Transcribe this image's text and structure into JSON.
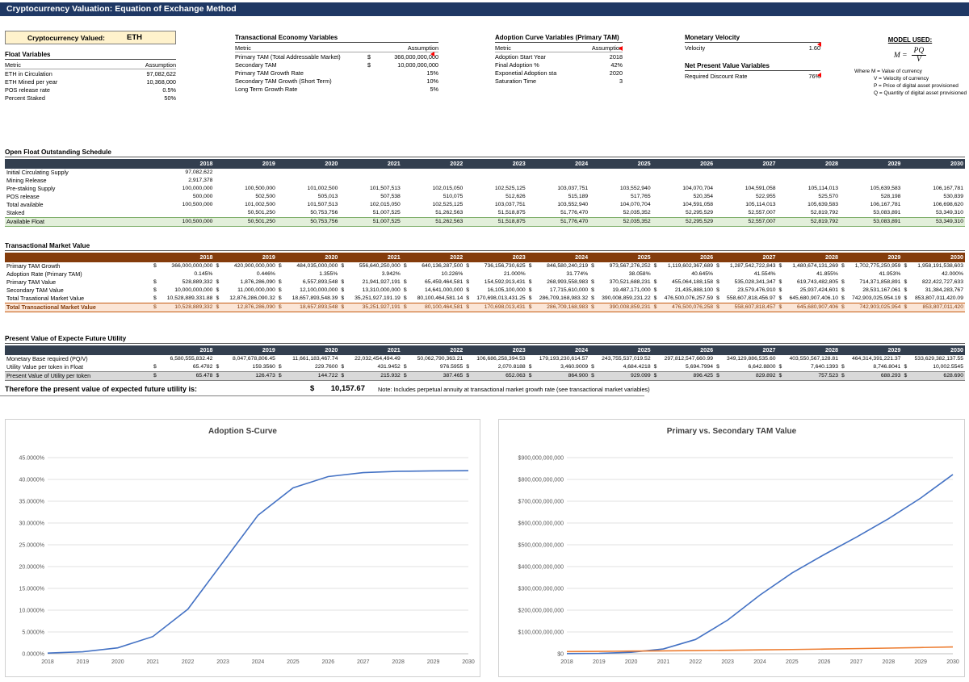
{
  "title_bar": {
    "title": "Cryptocurrency Valuation: Equation of Exchange Method"
  },
  "crypto_box": {
    "label": "Cryptocurrency Valued:",
    "value": "ETH"
  },
  "float_variables": {
    "title": "Float Variables",
    "headers": [
      "Metric",
      "Assumption"
    ],
    "rows": [
      {
        "metric": "ETH in Circulation",
        "value": "97,082,622"
      },
      {
        "metric": "ETH Mined per year",
        "value": "10,368,000"
      },
      {
        "metric": "POS release rate",
        "value": "0.5%"
      },
      {
        "metric": "Percent Staked",
        "value": "50%"
      }
    ]
  },
  "transactional_economy": {
    "title": "Transactional Economy Variables",
    "headers": [
      "Metric",
      "Assumption"
    ],
    "rows": [
      {
        "metric": "Primary TAM (Total Addressable Market)",
        "currency": "$",
        "value": "366,000,000,000"
      },
      {
        "metric": "Secondary TAM",
        "currency": "$",
        "value": "10,000,000,000"
      },
      {
        "metric": "Primary TAM Growth Rate",
        "value": "15%"
      },
      {
        "metric": "Secondary TAM Growth (Short Term)",
        "value": "10%"
      },
      {
        "metric": "Long Term Growth Rate",
        "value": "5%"
      }
    ]
  },
  "adoption_curve": {
    "title": "Adoption Curve Variables (Primary TAM)",
    "headers": [
      "Metric",
      "Assumption"
    ],
    "rows": [
      {
        "metric": "Adoption Start Year",
        "value": "2018"
      },
      {
        "metric": "Final Adoption %",
        "value": "42%"
      },
      {
        "metric": "Exponetial Adoption sta",
        "value": "2020"
      },
      {
        "metric": "Saturation Time",
        "value": "3"
      }
    ]
  },
  "monetary_velocity": {
    "title": "Monetary Velocity",
    "metric": "Velocity",
    "value": "1.60"
  },
  "npv_variables": {
    "title": "Net Present Value Variables",
    "metric": "Required Discount Rate",
    "value": "76%"
  },
  "model_used": {
    "title": "MODEL USED:",
    "formula_lhs": "M =",
    "formula_num": "PQ",
    "formula_den": "V",
    "legend": [
      "Where M = Value of currency",
      "V = Velocity of currency",
      "P = Price of digital asset provisioned",
      "Q = Quantity of digital asset provisioned"
    ]
  },
  "years": [
    "2018",
    "2019",
    "2020",
    "2021",
    "2022",
    "2023",
    "2024",
    "2025",
    "2026",
    "2027",
    "2028",
    "2029",
    "2030"
  ],
  "open_float": {
    "title": "Open Float Outstanding Schedule",
    "theme": "theme-slate",
    "rows": [
      {
        "label": "Initial Circulating Supply",
        "values": [
          "97,082,622",
          "",
          "",
          "",
          "",
          "",
          "",
          "",
          "",
          "",
          "",
          "",
          ""
        ]
      },
      {
        "label": "Mining Release",
        "values": [
          "2,917,378",
          "",
          "",
          "",
          "",
          "",
          "",
          "",
          "",
          "",
          "",
          "",
          ""
        ]
      },
      {
        "label": "Pre-staking Supply",
        "values": [
          "100,000,000",
          "100,500,000",
          "101,002,500",
          "101,507,513",
          "102,015,050",
          "102,525,125",
          "103,037,751",
          "103,552,940",
          "104,070,704",
          "104,591,058",
          "105,114,013",
          "105,639,583",
          "106,167,781"
        ]
      },
      {
        "label": "POS release",
        "values": [
          "500,000",
          "502,500",
          "505,013",
          "507,538",
          "510,075",
          "512,626",
          "515,189",
          "517,765",
          "520,354",
          "522,955",
          "525,570",
          "528,198",
          "530,839"
        ]
      },
      {
        "label": "Total available",
        "values": [
          "100,500,000",
          "101,002,500",
          "101,507,513",
          "102,015,050",
          "102,525,125",
          "103,037,751",
          "103,552,940",
          "104,070,704",
          "104,591,058",
          "105,114,013",
          "105,639,583",
          "106,167,781",
          "106,698,620"
        ]
      },
      {
        "label": "Staked",
        "values": [
          "",
          "50,501,250",
          "50,753,756",
          "51,007,525",
          "51,262,563",
          "51,518,875",
          "51,776,470",
          "52,035,352",
          "52,295,529",
          "52,557,007",
          "52,819,792",
          "53,083,891",
          "53,349,310"
        ]
      },
      {
        "label": "Available Float",
        "highlight": "green",
        "values": [
          "100,500,000",
          "50,501,250",
          "50,753,756",
          "51,007,525",
          "51,262,563",
          "51,518,875",
          "51,776,470",
          "52,035,352",
          "52,295,529",
          "52,557,007",
          "52,819,792",
          "53,083,891",
          "53,349,310"
        ]
      }
    ]
  },
  "transactional_market": {
    "title": "Transactional Market Value",
    "theme": "theme-rust",
    "rows": [
      {
        "label": "Primary TAM Growth",
        "currency": true,
        "values": [
          "366,000,000,000",
          "420,900,000,000",
          "484,035,000,000",
          "556,640,250,000",
          "640,136,287,500",
          "736,156,730,625",
          "846,580,240,219",
          "973,567,276,252",
          "1,119,602,367,689",
          "1,287,542,722,843",
          "1,480,674,131,269",
          "1,702,775,250,959",
          "1,958,191,538,603"
        ]
      },
      {
        "label": "Adoption Rate (Primary TAM)",
        "values": [
          "0.145%",
          "0.446%",
          "1.355%",
          "3.942%",
          "10.226%",
          "21.000%",
          "31.774%",
          "38.058%",
          "40.645%",
          "41.554%",
          "41.855%",
          "41.953%",
          "42.000%"
        ]
      },
      {
        "label": "Primary TAM Value",
        "currency": true,
        "values": [
          "528,889,332",
          "1,876,286,090",
          "6,557,893,548",
          "21,941,927,191",
          "65,459,464,581",
          "154,592,913,431",
          "268,993,558,983",
          "370,521,688,231",
          "455,064,188,158",
          "535,028,341,347",
          "619,743,482,805",
          "714,371,858,891",
          "822,422,727,633"
        ]
      },
      {
        "label": "Secondary TAM Value",
        "currency": true,
        "values": [
          "10,000,000,000",
          "11,000,000,000",
          "12,100,000,000",
          "13,310,000,000",
          "14,641,000,000",
          "16,105,100,000",
          "17,715,610,000",
          "19,487,171,000",
          "21,435,888,100",
          "23,579,476,910",
          "25,937,424,601",
          "28,531,167,061",
          "31,384,283,767"
        ]
      },
      {
        "label": "Total Trasational Market Value",
        "currency": true,
        "values": [
          "10,528,889,331.88",
          "12,876,286,090.32",
          "18,657,893,548.39",
          "35,251,927,191.19",
          "80,100,464,581.14",
          "170,698,013,431.25",
          "286,709,168,983.32",
          "390,008,859,231.22",
          "476,500,076,257.59",
          "558,607,818,456.97",
          "645,680,907,406.10",
          "742,903,025,954.19",
          "853,807,011,420.09"
        ]
      },
      {
        "label": "Total Transactional Market Value",
        "currency": true,
        "highlight": "orange",
        "values": [
          "10,528,889,332",
          "12,876,286,090",
          "18,657,893,548",
          "35,251,927,191",
          "80,100,464,581",
          "170,698,013,431",
          "286,709,168,983",
          "390,008,859,231",
          "476,500,076,258",
          "558,607,818,457",
          "645,680,907,406",
          "742,903,025,954",
          "853,807,011,420"
        ]
      }
    ]
  },
  "pv_utility": {
    "title": "Present Value of Expecte Future Utility",
    "theme": "theme-slate",
    "rows": [
      {
        "label": "Monetary Base required (PQ/V)",
        "values": [
          "6,580,555,832.42",
          "8,047,678,806.45",
          "11,661,183,467.74",
          "22,032,454,494.49",
          "50,062,790,363.21",
          "106,686,258,394.53",
          "179,193,230,614.57",
          "243,755,537,019.52",
          "297,812,547,660.99",
          "349,129,886,535.60",
          "403,550,567,128.81",
          "464,314,391,221.37",
          "533,629,382,137.55"
        ]
      },
      {
        "label": "Utility Value per token in Float",
        "currency": true,
        "values": [
          "65.4782",
          "159.3560",
          "229.7600",
          "431.9452",
          "976.5955",
          "2,070.8188",
          "3,460.9009",
          "4,684.4218",
          "5,694.7994",
          "6,642.8800",
          "7,640.1393",
          "8,746.8041",
          "10,002.5545"
        ]
      },
      {
        "label": "Present Value of Utility per token",
        "currency": true,
        "highlight": "gray",
        "values": [
          "65.478",
          "126.473",
          "144.722",
          "215.932",
          "387.465",
          "652.063",
          "864.900",
          "929.099",
          "896.425",
          "829.892",
          "757.523",
          "688.293",
          "628.690"
        ]
      }
    ]
  },
  "conclusion": {
    "text": "Therefore the present value of expected future utility is:",
    "currency": "$",
    "value": "10,157.67",
    "note": "Note: Includes perpetual annuity at transactional market growth rate (see transactional market variables)"
  },
  "chart_data": [
    {
      "type": "line",
      "title": "Adoption S-Curve",
      "x": [
        2018,
        2019,
        2020,
        2021,
        2022,
        2023,
        2024,
        2025,
        2026,
        2027,
        2028,
        2029,
        2030
      ],
      "series": [
        {
          "name": "Adoption Rate (Primary TAM)",
          "color": "#4472C4",
          "values": [
            0.145,
            0.446,
            1.355,
            3.942,
            10.226,
            21.0,
            31.774,
            38.058,
            40.645,
            41.554,
            41.855,
            41.953,
            42.0
          ]
        }
      ],
      "ylim": [
        0,
        45
      ],
      "y_ticks": [
        "0.0000%",
        "5.0000%",
        "10.0000%",
        "15.0000%",
        "20.0000%",
        "25.0000%",
        "30.0000%",
        "35.0000%",
        "40.0000%",
        "45.0000%"
      ],
      "grid": true,
      "legend_position": "none-visible"
    },
    {
      "type": "line",
      "title": "Primary vs. Secondary TAM Value",
      "x": [
        2018,
        2019,
        2020,
        2021,
        2022,
        2023,
        2024,
        2025,
        2026,
        2027,
        2028,
        2029,
        2030
      ],
      "series": [
        {
          "name": "Primary TAM Value",
          "color": "#4472C4",
          "values": [
            528889332,
            1876286090,
            6557893548,
            21941927191,
            65459464581,
            154592913431,
            268993558983,
            370521688231,
            455064188158,
            535028341347,
            619743482805,
            714371858891,
            822422727633
          ]
        },
        {
          "name": "Secondary TAM Value",
          "color": "#ED7D31",
          "values": [
            10000000000,
            11000000000,
            12100000000,
            13310000000,
            14641000000,
            16105100000,
            17715610000,
            19487171000,
            21435888100,
            23579476910,
            25937424601,
            28531167061,
            31384283767
          ]
        }
      ],
      "ylim": [
        0,
        900000000000
      ],
      "y_ticks": [
        "$0",
        "$100,000,000,000",
        "$200,000,000,000",
        "$300,000,000,000",
        "$400,000,000,000",
        "$500,000,000,000",
        "$600,000,000,000",
        "$700,000,000,000",
        "$800,000,000,000",
        "$900,000,000,000"
      ],
      "grid": true,
      "legend_position": "none-visible"
    }
  ]
}
